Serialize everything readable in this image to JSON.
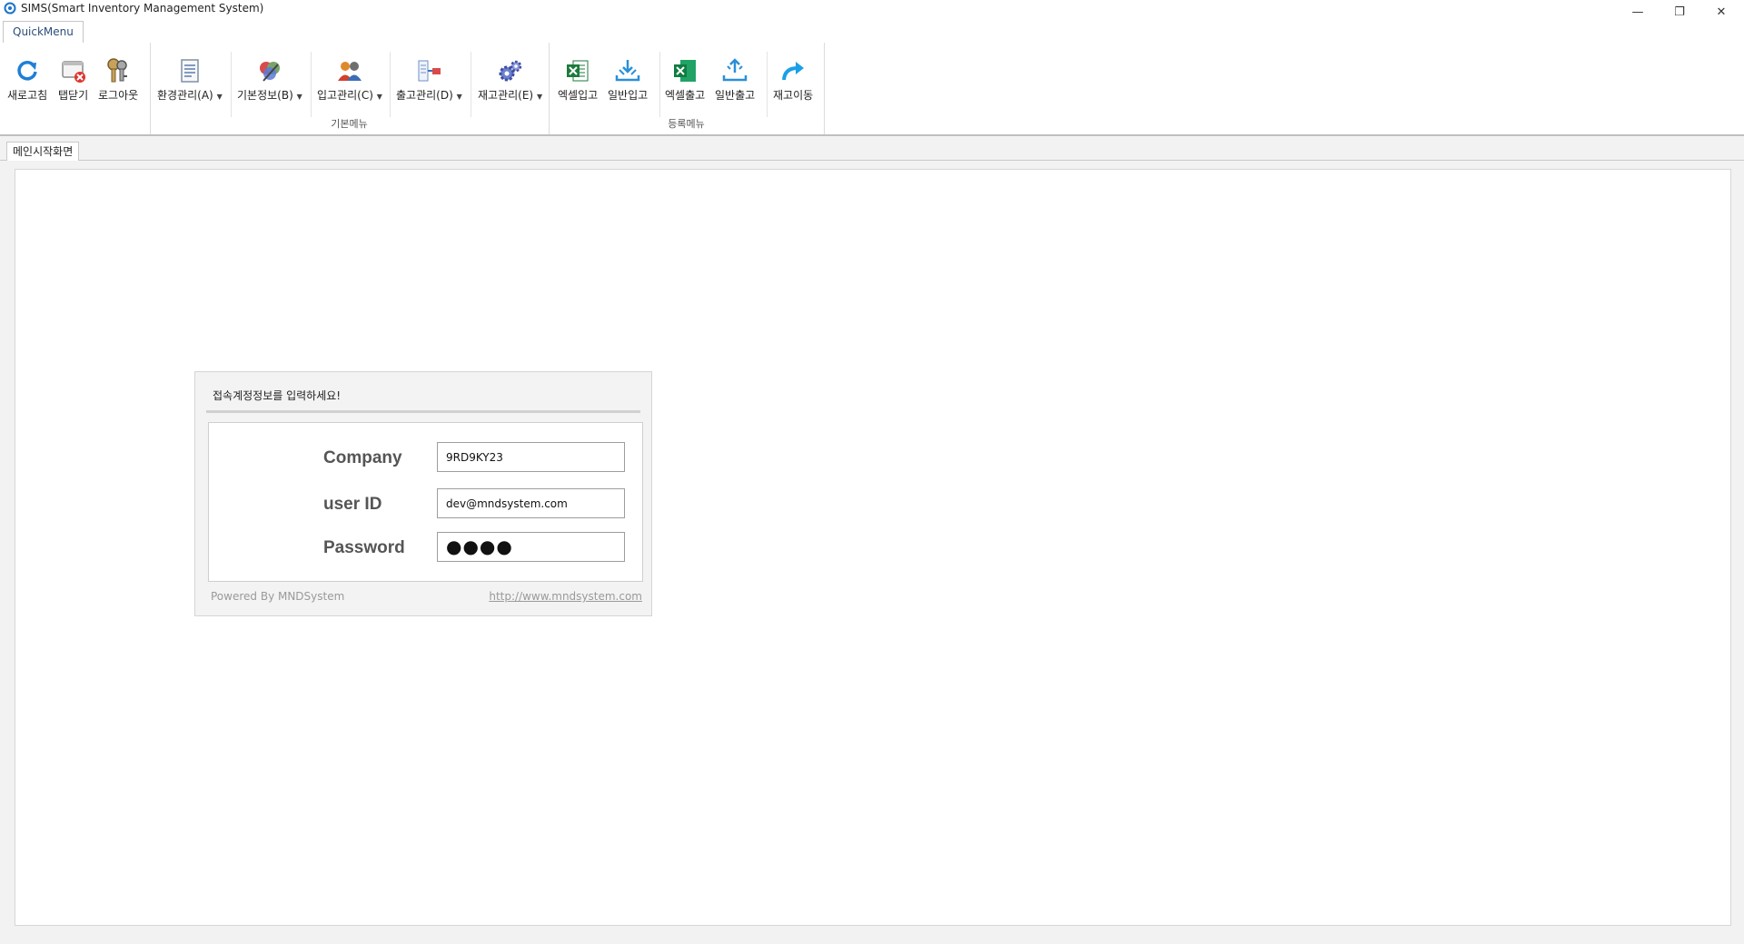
{
  "window": {
    "title": "SIMS(Smart Inventory Management System)",
    "controls": {
      "minimize": "—",
      "maximize": "❐",
      "close": "✕"
    }
  },
  "ribbon": {
    "tab": "QuickMenu",
    "groups": {
      "quick": {
        "refresh": "새로고침",
        "close_tab": "탭닫기",
        "logout": "로그아웃"
      },
      "basic": {
        "label": "기본메뉴",
        "env": "환경관리(A)",
        "info": "기본정보(B)",
        "inbound": "입고관리(C)",
        "outbound": "출고관리(D)",
        "stock": "재고관리(E)"
      },
      "register": {
        "label": "등록메뉴",
        "excel_in": "엑셀입고",
        "normal_in": "일반입고",
        "excel_out": "엑셀출고",
        "normal_out": "일반출고",
        "move": "재고이동"
      }
    },
    "colors": {
      "refresh": "#1e7fd6",
      "excel": "#1d7a3d",
      "arrow": "#2a8fd8",
      "move": "#1aa0e6"
    }
  },
  "doc_tab": "메인시작화면",
  "login": {
    "header": "접속계정정보를 입력하세요!",
    "company_label": "Company",
    "company_value": "9RD9KY23",
    "user_label": "user ID",
    "user_value": "dev@mndsystem.com",
    "password_label": "Password",
    "password_mask": "●●●●",
    "powered": "Powered By MNDSystem",
    "url": "http://www.mndsystem.com"
  }
}
